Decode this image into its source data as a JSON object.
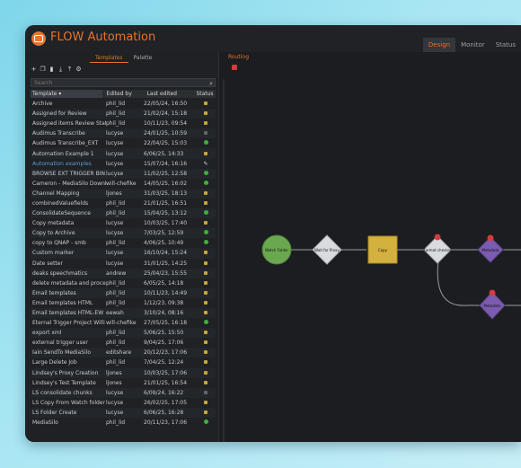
{
  "app": {
    "title": "FLOW Automation"
  },
  "topnav": {
    "tabs": [
      "Design",
      "Monitor",
      "Status"
    ]
  },
  "left": {
    "subtabs": [
      "Templates",
      "Palette"
    ],
    "search_placeholder": "Search",
    "columns": {
      "template": "Template",
      "edited_by": "Edited by",
      "last_edited": "Last edited",
      "status": "Status"
    },
    "rows": [
      {
        "name": "Archive",
        "by": "phil_lid",
        "date": "22/05/24, 16:50",
        "status": "lock"
      },
      {
        "name": "Assigned for Review",
        "by": "phil_lid",
        "date": "21/02/24, 15:18",
        "status": "lock"
      },
      {
        "name": "Assigned items Review Stats",
        "by": "phil_lid",
        "date": "10/11/23, 09:54",
        "status": "lock"
      },
      {
        "name": "Audimus Transcribe",
        "by": "lucyse",
        "date": "24/01/25, 10:59",
        "status": "dim"
      },
      {
        "name": "Audimus Transcribe_EXT",
        "by": "lucyse",
        "date": "22/04/25, 15:03",
        "status": "green"
      },
      {
        "name": "Automation Example 1",
        "by": "lucyse",
        "date": "6/06/25, 14:33",
        "status": "lock"
      },
      {
        "name": "Automation examples",
        "by": "lucyse",
        "date": "15/07/24, 16:16",
        "status": "pen",
        "highlight": true
      },
      {
        "name": "BROWSE EXT TRIGGER BIN X",
        "by": "lucyse",
        "date": "11/02/25, 12:58",
        "status": "green"
      },
      {
        "name": "Cameron - MediaSilo Download",
        "by": "will-chefike",
        "date": "14/05/25, 16:02",
        "status": "green"
      },
      {
        "name": "Channel Mapping",
        "by": "ljones",
        "date": "31/03/25, 18:13",
        "status": "lock"
      },
      {
        "name": "combinedValuefields",
        "by": "phil_lid",
        "date": "21/01/25, 16:51",
        "status": "lock"
      },
      {
        "name": "ConsolidateSequence",
        "by": "phil_lid",
        "date": "15/04/25, 13:12",
        "status": "green"
      },
      {
        "name": "Copy metadata",
        "by": "lucyse",
        "date": "10/03/25, 17:40",
        "status": "lock"
      },
      {
        "name": "Copy to Archive",
        "by": "lucyse",
        "date": "7/03/25, 12:59",
        "status": "green"
      },
      {
        "name": "copy to QNAP - smb",
        "by": "phil_lid",
        "date": "4/06/25, 10:49",
        "status": "green"
      },
      {
        "name": "Custom marker",
        "by": "lucyse",
        "date": "16/10/24, 15:24",
        "status": "lock"
      },
      {
        "name": "Date setter",
        "by": "lucyse",
        "date": "31/01/25, 14:25",
        "status": "lock"
      },
      {
        "name": "deaks speechmatics",
        "by": "andrew",
        "date": "25/04/23, 15:55",
        "status": "lock"
      },
      {
        "name": "delete metadata and process",
        "by": "phil_lid",
        "date": "6/05/25, 14:18",
        "status": "lock"
      },
      {
        "name": "Email templates",
        "by": "phil_lid",
        "date": "10/11/23, 14:49",
        "status": "lock"
      },
      {
        "name": "Email templates HTML",
        "by": "phil_lid",
        "date": "1/12/23, 09:38",
        "status": "lock"
      },
      {
        "name": "Email templates HTML-EW",
        "by": "eewah",
        "date": "3/10/24, 08:16",
        "status": "lock"
      },
      {
        "name": "Eternal Trigger Project Willi",
        "by": "will-chefike",
        "date": "27/05/25, 16:18",
        "status": "green"
      },
      {
        "name": "export xml",
        "by": "phil_lid",
        "date": "5/06/25, 15:50",
        "status": "lock"
      },
      {
        "name": "external trigger user",
        "by": "phil_lid",
        "date": "9/04/25, 17:06",
        "status": "lock"
      },
      {
        "name": "Iain SendTo MediaSilo",
        "by": "editshare",
        "date": "20/12/23, 17:06",
        "status": "lock"
      },
      {
        "name": "Large Delete Job",
        "by": "phil_lid",
        "date": "7/04/25, 12:24",
        "status": "lock"
      },
      {
        "name": "Lindsey's Proxy Creation",
        "by": "ljones",
        "date": "10/03/25, 17:06",
        "status": "lock"
      },
      {
        "name": "Lindsey's Test Template",
        "by": "ljones",
        "date": "21/01/25, 16:54",
        "status": "lock"
      },
      {
        "name": "LS consolidate chunks",
        "by": "lucyse",
        "date": "6/09/24, 16:22",
        "status": "dim"
      },
      {
        "name": "LS Copy From Watch folder",
        "by": "lucyse",
        "date": "26/02/25, 17:05",
        "status": "lock"
      },
      {
        "name": "LS Folder Create",
        "by": "lucyse",
        "date": "6/06/25, 16:28",
        "status": "lock"
      },
      {
        "name": "MediaSilo",
        "by": "phil_lid",
        "date": "20/11/23, 17:06",
        "status": "green"
      }
    ]
  },
  "canvas": {
    "tab": "Routing",
    "nodes": {
      "watch": "Watch Folder",
      "wait": "Wait for Proxy",
      "copy": "Copy",
      "format": "Format checker",
      "meta1": "Metadata",
      "meta2": "Metadata"
    }
  },
  "colors": {
    "accent": "#e8732a",
    "start_node": "#6aa84f",
    "copy_node": "#d4b13e",
    "meta_node": "#7b5cb0",
    "status_green": "#3db13a"
  }
}
